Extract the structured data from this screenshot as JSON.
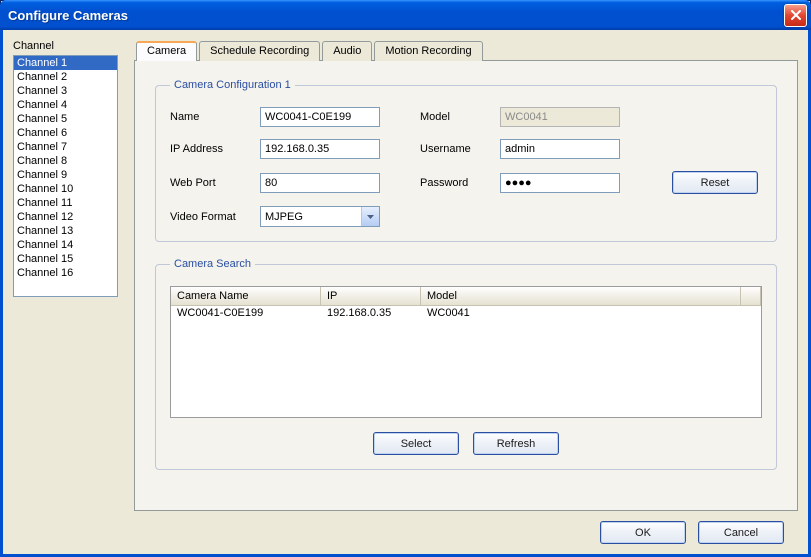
{
  "window": {
    "title": "Configure Cameras"
  },
  "sidebar": {
    "label": "Channel",
    "items": [
      "Channel 1",
      "Channel 2",
      "Channel 3",
      "Channel 4",
      "Channel 5",
      "Channel 6",
      "Channel 7",
      "Channel 8",
      "Channel 9",
      "Channel 10",
      "Channel 11",
      "Channel 12",
      "Channel 13",
      "Channel 14",
      "Channel 15",
      "Channel 16"
    ],
    "selected_index": 0
  },
  "tabs": {
    "items": [
      "Camera",
      "Schedule Recording",
      "Audio",
      "Motion Recording"
    ],
    "active_index": 0
  },
  "config_group": {
    "legend": "Camera Configuration 1",
    "labels": {
      "name": "Name",
      "ip": "IP Address",
      "port": "Web Port",
      "vformat": "Video Format",
      "model": "Model",
      "user": "Username",
      "pass": "Password"
    },
    "values": {
      "name": "WC0041-C0E199",
      "ip": "192.168.0.35",
      "port": "80",
      "vformat": "MJPEG",
      "model": "WC0041",
      "user": "admin",
      "pass_mask": "●●●●"
    },
    "buttons": {
      "reset": "Reset"
    }
  },
  "search_group": {
    "legend": "Camera Search",
    "columns": {
      "name": "Camera Name",
      "ip": "IP",
      "model": "Model"
    },
    "rows": [
      {
        "name": "WC0041-C0E199",
        "ip": "192.168.0.35",
        "model": "WC0041"
      }
    ],
    "buttons": {
      "select": "Select",
      "refresh": "Refresh"
    }
  },
  "footer": {
    "ok": "OK",
    "cancel": "Cancel"
  }
}
